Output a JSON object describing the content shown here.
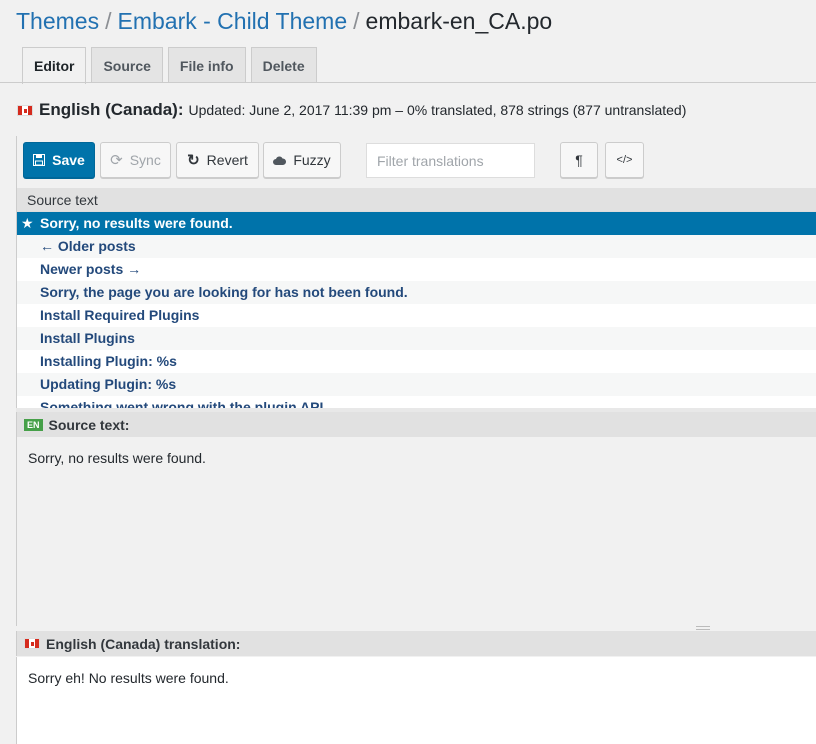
{
  "breadcrumb": {
    "root": "Themes",
    "theme": "Embark - Child Theme",
    "file": "embark-en_CA.po"
  },
  "tabs": [
    "Editor",
    "Source",
    "File info",
    "Delete"
  ],
  "status": {
    "language": "English (Canada):",
    "summary": "Updated: June 2, 2017 11:39 pm – 0% translated, 878 strings (877 untranslated)"
  },
  "toolbar": {
    "save": "Save",
    "sync": "Sync",
    "revert": "Revert",
    "fuzzy": "Fuzzy",
    "filter_placeholder": "Filter translations",
    "pilcrow": "¶",
    "code": "</>"
  },
  "list": {
    "header": "Source text",
    "rows": [
      "Sorry, no results were found.",
      "← Older posts",
      "Newer posts →",
      "Sorry, the page you are looking for has not been found.",
      "Install Required Plugins",
      "Install Plugins",
      "Installing Plugin: %s",
      "Updating Plugin: %s",
      "Something went wrong with the plugin API."
    ]
  },
  "source_pane": {
    "badge": "EN",
    "title": "Source text:",
    "text": "Sorry, no results were found."
  },
  "translation_pane": {
    "title": "English (Canada) translation:",
    "text": "Sorry eh! No results were found."
  },
  "colors": {
    "primary": "#0073aa",
    "link": "#2271b1",
    "row_text": "#23497b",
    "en_badge": "#46a049"
  }
}
